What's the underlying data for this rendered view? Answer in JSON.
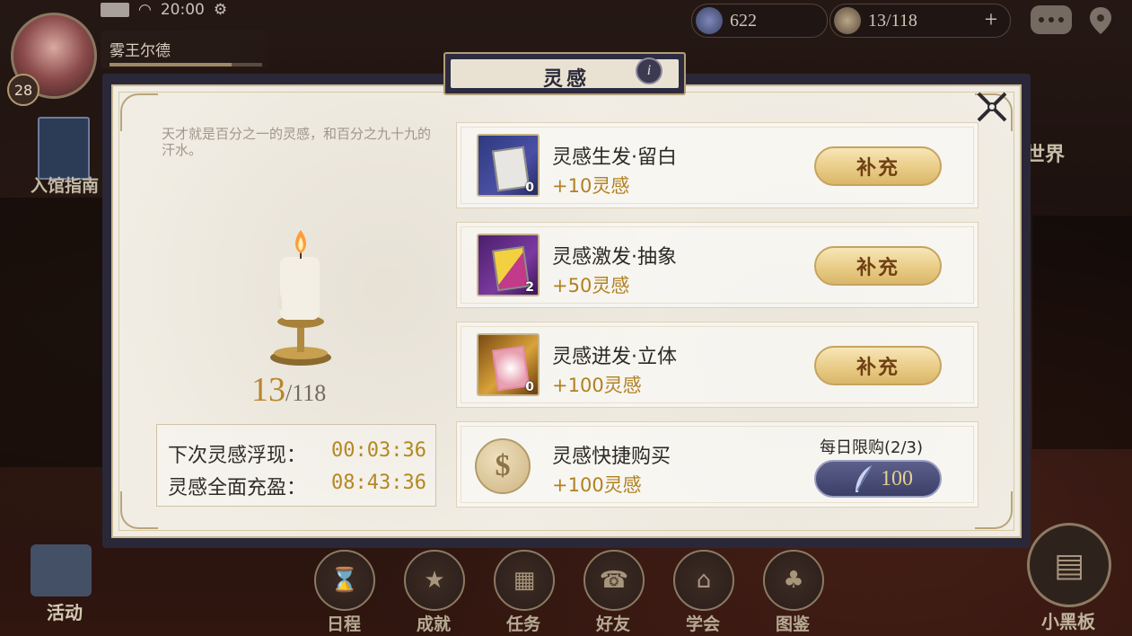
{
  "status_bar": {
    "time": "20:00"
  },
  "player": {
    "name": "雾王尔德",
    "level": "28"
  },
  "resources": {
    "quill": {
      "value": "622"
    },
    "inspiration": {
      "value": "13/118",
      "plus": "+"
    }
  },
  "side_left": {
    "guide_label": "入馆指南",
    "activity_label": "活动"
  },
  "side_right": {
    "world_label": "世界",
    "board_label": "小黑板"
  },
  "dock": [
    {
      "label": "日程",
      "icon": "hourglass-icon"
    },
    {
      "label": "成就",
      "icon": "star-badge-icon"
    },
    {
      "label": "任务",
      "icon": "task-board-icon"
    },
    {
      "label": "好友",
      "icon": "telephone-icon"
    },
    {
      "label": "学会",
      "icon": "building-icon"
    },
    {
      "label": "图鉴",
      "icon": "tree-icon"
    }
  ],
  "dialog": {
    "title": "灵感",
    "info": "i",
    "quote": "天才就是百分之一的灵感，和百分之九十九的汗水。",
    "current": "13",
    "max": "/118",
    "timers": [
      {
        "label": "下次灵感浮现：",
        "value": "00:03:36"
      },
      {
        "label": "灵感全面充盈：",
        "value": "08:43:36"
      }
    ],
    "items": [
      {
        "name": "灵感生发·留白",
        "gain": "+10灵感",
        "count": "0",
        "button": "补充"
      },
      {
        "name": "灵感激发·抽象",
        "gain": "+50灵感",
        "count": "2",
        "button": "补充"
      },
      {
        "name": "灵感迸发·立体",
        "gain": "+100灵感",
        "count": "0",
        "button": "补充"
      }
    ],
    "quick_buy": {
      "name": "灵感快捷购买",
      "gain": "+100灵感",
      "limit": "每日限购(2/3)",
      "price": "100",
      "coin_symbol": "$"
    }
  },
  "colors": {
    "accent_gold": "#b08122",
    "panel_bg": "#f1ede4",
    "frame_dark": "#2a2838"
  }
}
